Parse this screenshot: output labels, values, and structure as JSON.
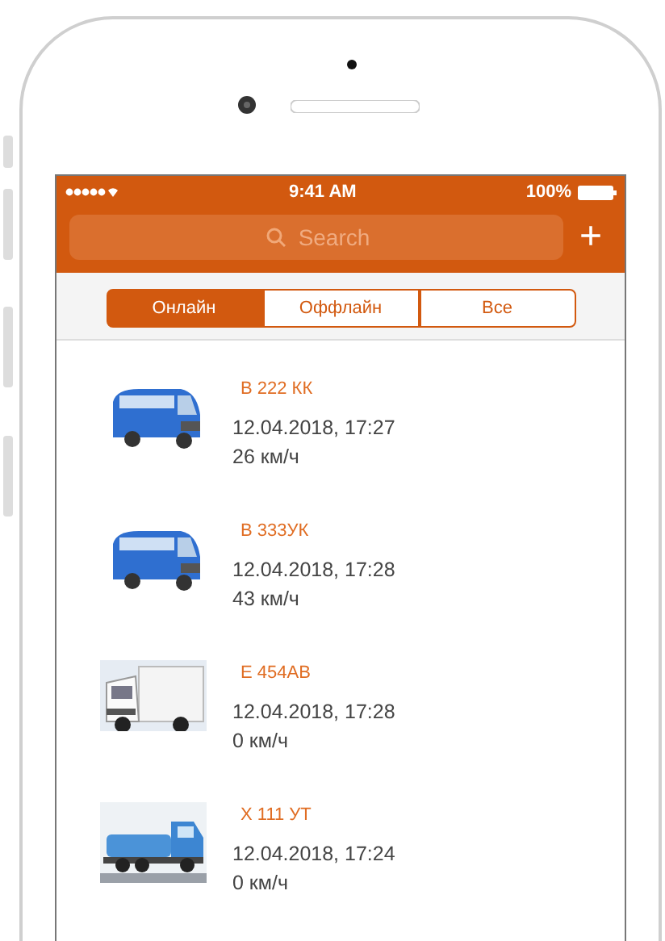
{
  "status_bar": {
    "time": "9:41 AM",
    "battery": "100%"
  },
  "search": {
    "placeholder": "Search",
    "add_button": "+"
  },
  "tabs": [
    {
      "label": "Онлайн",
      "selected": true
    },
    {
      "label": "Оффлайн",
      "selected": false
    },
    {
      "label": "Все",
      "selected": false
    }
  ],
  "vehicles": [
    {
      "plate": "В 222 КК",
      "datetime": "12.04.2018, 17:27",
      "speed": "26 км/ч",
      "kind": "van"
    },
    {
      "plate": "В 333УК",
      "datetime": "12.04.2018, 17:28",
      "speed": "43 км/ч",
      "kind": "van"
    },
    {
      "plate": "Е 454АВ",
      "datetime": "12.04.2018, 17:28",
      "speed": "0 км/ч",
      "kind": "truck"
    },
    {
      "plate": "Х 111 УТ",
      "datetime": "12.04.2018, 17:24",
      "speed": "0 км/ч",
      "kind": "tanker"
    }
  ]
}
